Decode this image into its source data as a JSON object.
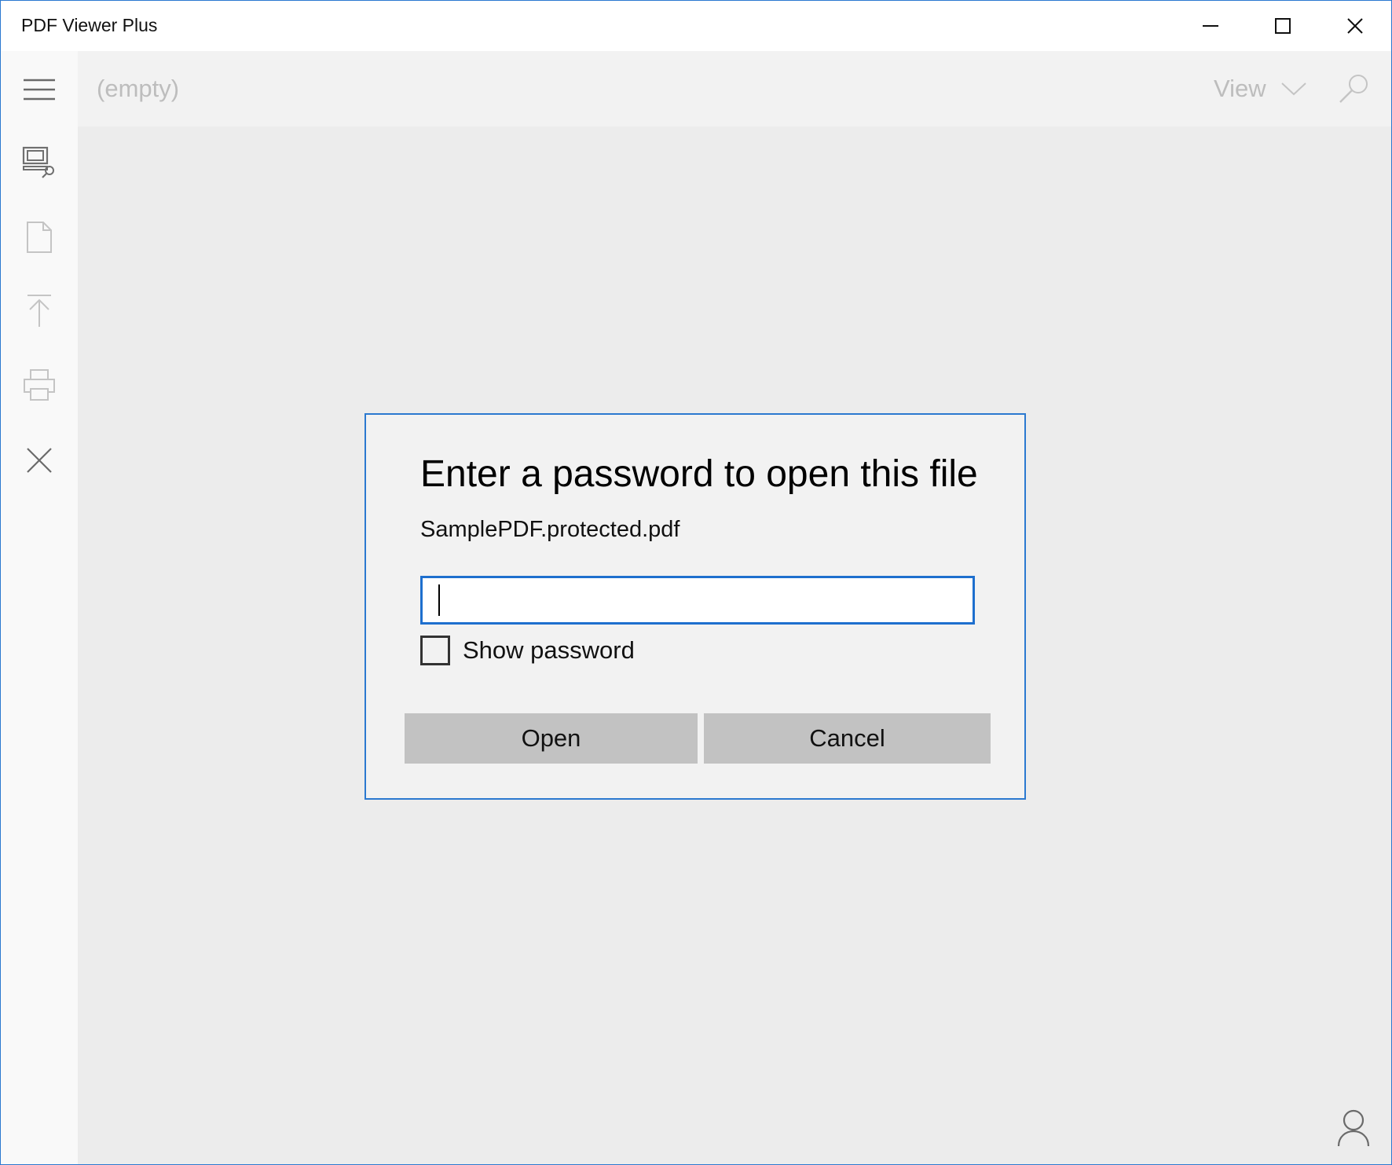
{
  "window": {
    "title": "PDF Viewer Plus",
    "controls": [
      "minimize-icon",
      "maximize-icon",
      "close-icon"
    ]
  },
  "command_bar": {
    "document_name": "(empty)",
    "view_label": "View",
    "icons": [
      "chevron-down-icon",
      "search-icon"
    ]
  },
  "rail": {
    "items": [
      {
        "icon": "hamburger-menu-icon"
      },
      {
        "icon": "browse-files-icon"
      },
      {
        "icon": "document-icon"
      },
      {
        "icon": "upload-icon"
      },
      {
        "icon": "printer-icon"
      },
      {
        "icon": "close-icon"
      }
    ]
  },
  "dialog": {
    "title": "Enter a password to open this file",
    "file_name": "SamplePDF.protected.pdf",
    "password_value": "",
    "show_password_label": "Show password",
    "show_password_checked": false,
    "open_label": "Open",
    "cancel_label": "Cancel"
  },
  "footer": {
    "account_icon": "person-icon"
  },
  "colors": {
    "accent": "#2b79d0",
    "input_border": "#1e6fce",
    "button_bg": "#c2c2c2",
    "dialog_bg": "#f2f2f2",
    "content_bg": "#ececec",
    "disabled_text": "#bdbdbd"
  }
}
